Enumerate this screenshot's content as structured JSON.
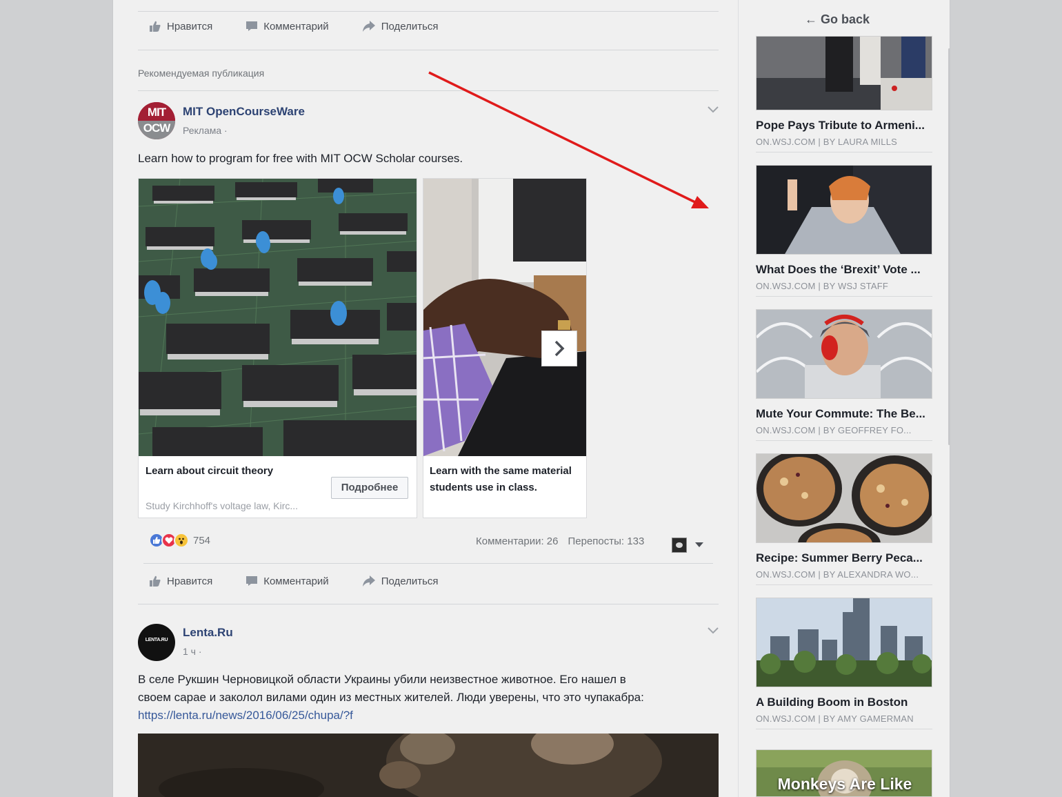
{
  "feed": {
    "top_actions": {
      "like": "Нравится",
      "comment": "Комментарий",
      "share": "Поделиться"
    },
    "recommended_label": "Рекомендуемая публикация",
    "ad_post": {
      "page_name": "MIT OpenCourseWare",
      "avatar_text_top": "MIT",
      "avatar_text_bottom": "OCW",
      "sponsored": "Реклама ·",
      "text": "Learn how to program for free with MIT OCW Scholar courses.",
      "cards": [
        {
          "title": "Learn about circuit theory",
          "description": "Study Kirchhoff's voltage law, Kirc...",
          "button": "Подробнее"
        },
        {
          "title_line1": "Learn with the same material",
          "title_line2": "students use in class."
        }
      ],
      "reaction_count": "754",
      "comments": "Комментарии: 26",
      "shares": "Перепосты: 133",
      "actions": {
        "like": "Нравится",
        "comment": "Комментарий",
        "share": "Поделиться"
      }
    },
    "lenta_post": {
      "page_name": "Lenta.Ru",
      "avatar_text": "LENTA.RU",
      "time": "1 ч ·",
      "text_line1": "В селе Рукшин Черновицкой области Украины убили неизвестное животное. Его нашел в",
      "text_line2": "своем сарае и заколол вилами один из местных жителей. Люди уверены, что это чупакабра:",
      "link": "https://lenta.ru/news/2016/06/25/chupa/?f"
    }
  },
  "sidebar": {
    "go_back": "← Go back",
    "items": [
      {
        "title": "Pope Pays Tribute to Armeni...",
        "source": "ON.WSJ.COM",
        "sep": "|",
        "author": "BY LAURA MILLS"
      },
      {
        "title": "What Does the ‘Brexit’ Vote ...",
        "source": "ON.WSJ.COM",
        "sep": "|",
        "author": "BY WSJ STAFF"
      },
      {
        "title": "Mute Your Commute: The Be...",
        "source": "ON.WSJ.COM",
        "sep": "|",
        "author": "BY GEOFFREY FO..."
      },
      {
        "title": "Recipe: Summer Berry Peca...",
        "source": "ON.WSJ.COM",
        "sep": "|",
        "author": "BY ALEXANDRA WO..."
      },
      {
        "title": "A Building Boom in Boston",
        "source": "ON.WSJ.COM",
        "sep": "|",
        "author": "BY AMY GAMERMAN"
      },
      {
        "overlay": "Monkeys Are Like"
      }
    ]
  },
  "colors": {
    "link_blue": "#365899",
    "name_blue": "#2d4373",
    "like_blue": "#4a78d6",
    "love_red": "#e8334a",
    "wow_yellow": "#f7c33a",
    "annotation_arrow": "#e01b1b"
  },
  "icons": [
    "thumbs-up-icon",
    "comment-icon",
    "share-arrow-icon",
    "chevron-down-icon",
    "chevron-right-icon",
    "like-reaction-icon",
    "love-reaction-icon",
    "wow-reaction-icon",
    "caret-down-icon"
  ]
}
